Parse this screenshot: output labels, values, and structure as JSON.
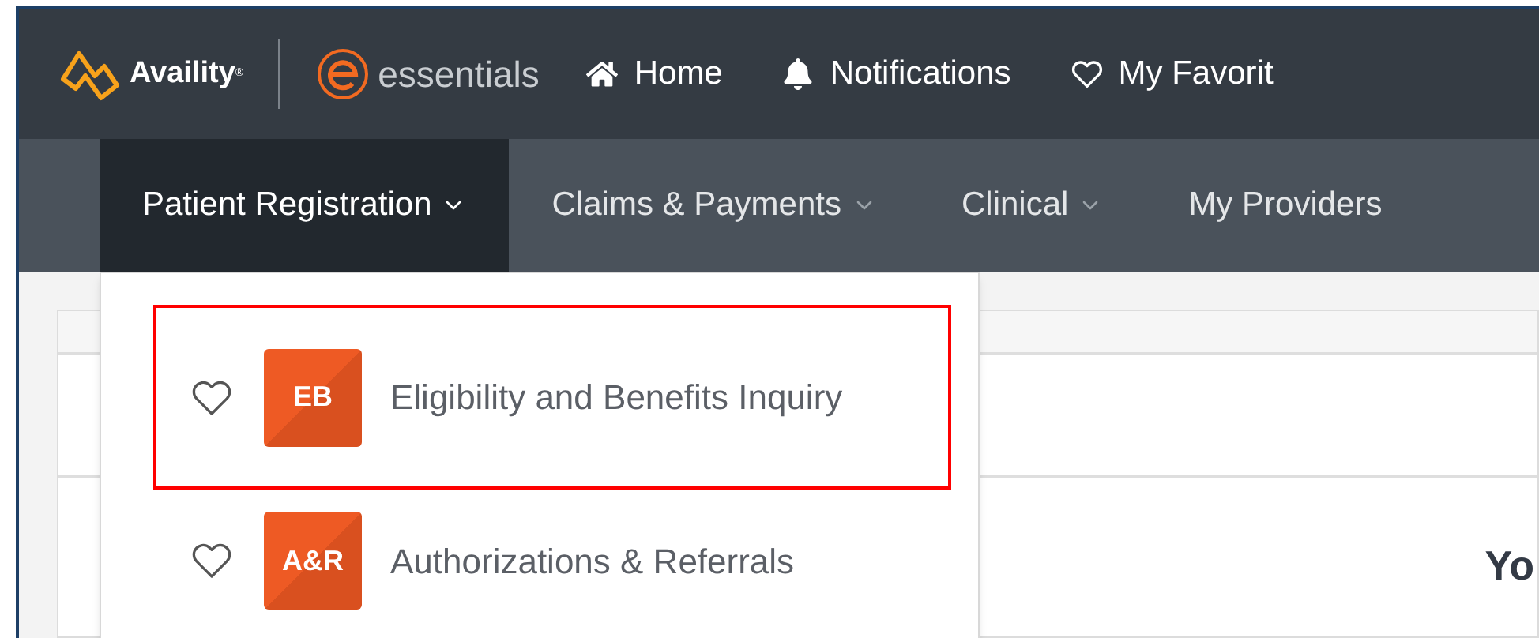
{
  "brand": {
    "name": "Availity",
    "mark": "®",
    "product": "essentials"
  },
  "top_nav": [
    {
      "label": "Home",
      "kind": "home"
    },
    {
      "label": "Notifications",
      "kind": "bell"
    },
    {
      "label": "My Favorit",
      "kind": "heart"
    }
  ],
  "main_nav": [
    {
      "label": "Patient Registration",
      "selected": true,
      "has_menu": true
    },
    {
      "label": "Claims & Payments",
      "selected": false,
      "has_menu": true
    },
    {
      "label": "Clinical",
      "selected": false,
      "has_menu": true
    },
    {
      "label": "My Providers",
      "selected": false,
      "has_menu": false
    }
  ],
  "dropdown": {
    "items": [
      {
        "badge": "EB",
        "label": "Eligibility and Benefits Inquiry",
        "highlighted": true
      },
      {
        "badge": "A&R",
        "label": "Authorizations & Referrals",
        "highlighted": false
      }
    ]
  },
  "content": {
    "heading": "Yo"
  }
}
